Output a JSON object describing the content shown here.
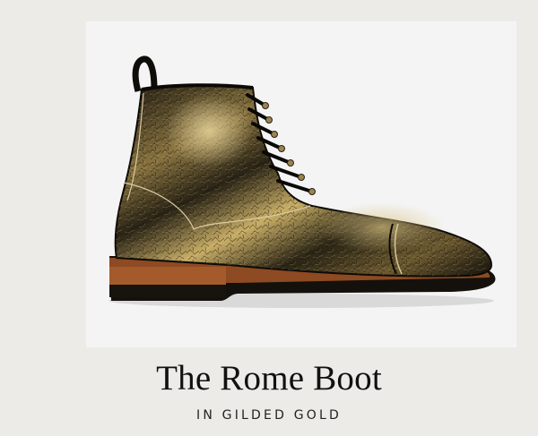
{
  "product": {
    "title": "The Rome Boot",
    "subtitle": "IN GILDED GOLD",
    "image_alt": "boot-image"
  },
  "colors": {
    "background": "#ecebe7",
    "photo_background": "#f4f4f4",
    "leather_dark": "#15120b",
    "leather_gold": "#b59a56",
    "sole_brown": "#8e4a22",
    "text": "#111111"
  }
}
